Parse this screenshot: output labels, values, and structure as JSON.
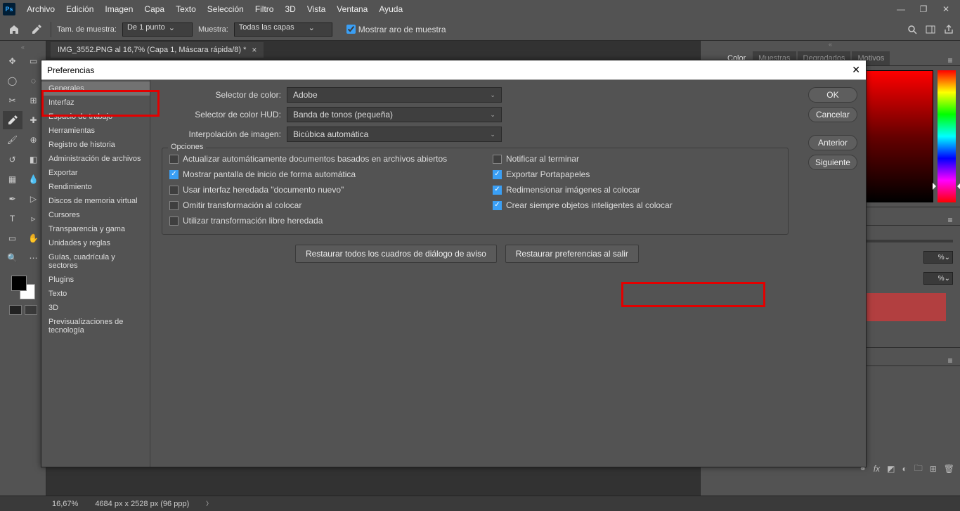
{
  "app": {
    "logo": "Ps"
  },
  "menu": [
    "Archivo",
    "Edición",
    "Imagen",
    "Capa",
    "Texto",
    "Selección",
    "Filtro",
    "3D",
    "Vista",
    "Ventana",
    "Ayuda"
  ],
  "options_bar": {
    "sample_size_label": "Tam. de muestra:",
    "sample_size_value": "De 1 punto",
    "sample_label": "Muestra:",
    "sample_value": "Todas las capas",
    "show_ring_label": "Mostrar aro de muestra"
  },
  "document_tab": {
    "title": "IMG_3552.PNG al 16,7% (Capa 1, Máscara rápida/8) *"
  },
  "color_panel": {
    "tabs": [
      "Color",
      "Muestras",
      "Degradados",
      "Motivos"
    ]
  },
  "mid_percent": "%",
  "statusbar": {
    "zoom": "16,67%",
    "dims": "4684 px x 2528 px (96 ppp)"
  },
  "prefs": {
    "title": "Preferencias",
    "sidebar": [
      "Generales",
      "Interfaz",
      "Espacio de trabajo",
      "Herramientas",
      "Registro de historia",
      "Administración de archivos",
      "Exportar",
      "Rendimiento",
      "Discos de memoria virtual",
      "Cursores",
      "Transparencia y gama",
      "Unidades y reglas",
      "Guías, cuadrícula y sectores",
      "Plugins",
      "Texto",
      "3D",
      "Previsualizaciones de tecnología"
    ],
    "labels": {
      "color_picker": "Selector de color:",
      "hud_picker": "Selector de color HUD:",
      "interpolation": "Interpolación de imagen:",
      "options": "Opciones"
    },
    "selects": {
      "color_picker": "Adobe",
      "hud_picker": "Banda de tonos (pequeña)",
      "interpolation": "Bicúbica automática"
    },
    "checks_left": [
      {
        "label": "Actualizar automáticamente documentos basados en archivos abiertos",
        "checked": false
      },
      {
        "label": "Mostrar pantalla de inicio de forma automática",
        "checked": true
      },
      {
        "label": "Usar interfaz heredada \"documento nuevo\"",
        "checked": false
      },
      {
        "label": "Omitir transformación al colocar",
        "checked": false
      },
      {
        "label": "Utilizar transformación libre heredada",
        "checked": false
      }
    ],
    "checks_right": [
      {
        "label": "Notificar al terminar",
        "checked": false
      },
      {
        "label": "Exportar Portapapeles",
        "checked": true
      },
      {
        "label": "Redimensionar imágenes al colocar",
        "checked": true
      },
      {
        "label": "Crear siempre objetos inteligentes al colocar",
        "checked": true
      }
    ],
    "reset_buttons": {
      "warnings": "Restaurar todos los cuadros de diálogo de aviso",
      "on_quit": "Restaurar preferencias al salir"
    },
    "right_buttons": {
      "ok": "OK",
      "cancel": "Cancelar",
      "prev": "Anterior",
      "next": "Siguiente"
    }
  }
}
